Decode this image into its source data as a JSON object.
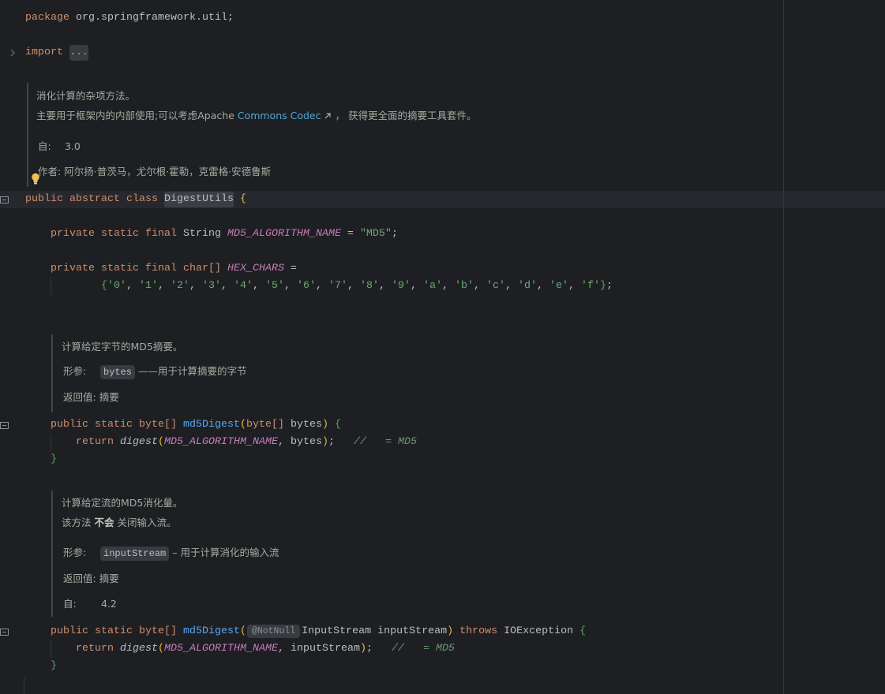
{
  "editor": {
    "colors": {
      "background": "#1e1f22",
      "caret_row": "#26282e",
      "keyword": "#cf8e6d",
      "text": "#bcbec4",
      "constant": "#c77dbb",
      "string": "#6aab73",
      "method_declaration": "#56a8f5",
      "comment": "#6b9a74",
      "bracket_level_1": "#e8ba36",
      "bracket_level_2": "#54a857",
      "doc_text": "#a3aca1",
      "doc_link": "#4ea6d8"
    },
    "icons": {
      "fold_toggle": "chevron-right-icon",
      "rendered_doc_toggle": "rendered-doc-toggle-icon",
      "intention_action": "lightbulb-icon",
      "external_link": "external-link-icon"
    }
  },
  "code": {
    "package_line": [
      "package",
      " org.springframework.util;"
    ],
    "import_line": [
      "import ",
      "..."
    ],
    "class_line": [
      "public abstract class ",
      "DigestUtils",
      " {"
    ],
    "md5_field_line": [
      "private static final",
      " String ",
      "MD5_ALGORITHM_NAME",
      " = ",
      "\"MD5\"",
      ";"
    ],
    "hex_field_line": [
      "private static final char[] ",
      "HEX_CHARS",
      " ="
    ],
    "hex_values_line": {
      "open": "{",
      "items": [
        "'0'",
        "'1'",
        "'2'",
        "'3'",
        "'4'",
        "'5'",
        "'6'",
        "'7'",
        "'8'",
        "'9'",
        "'a'",
        "'b'",
        "'c'",
        "'d'",
        "'e'",
        "'f'"
      ],
      "separator": ", ",
      "close": "}",
      "terminator": ";"
    },
    "md5_bytes_signature": [
      "public static byte[] ",
      "md5Digest",
      "(",
      "byte[]",
      " bytes",
      ")",
      " {"
    ],
    "md5_bytes_return": [
      "return ",
      "digest",
      "(",
      "MD5_ALGORITHM_NAME",
      ", bytes",
      ")",
      ";   ",
      "//   = MD5"
    ],
    "md5_bytes_close": [
      "}"
    ],
    "md5_stream_signature": [
      "public static byte[] ",
      "md5Digest",
      "(",
      "@NotNull",
      "InputStream inputStream",
      ")",
      " throws",
      " IOException",
      " {"
    ],
    "md5_stream_return": [
      "return ",
      "digest",
      "(",
      "MD5_ALGORITHM_NAME",
      ", inputStream",
      ")",
      ";   ",
      "//   = MD5"
    ],
    "md5_stream_close": [
      "}"
    ]
  },
  "docs": {
    "class_doc": {
      "summary": "消化计算的杂项方法。",
      "note_before_link": "主要用于框架内的内部使用;可以考虑Apache ",
      "link_text": "Commons Codec",
      "note_after_link": " ， 获得更全面的摘要工具套件。",
      "since_label": "自:",
      "since_value": "3.0",
      "author_label": "作者:",
      "author_value": "阿尔扬·普茨马，尤尔根·霍勒，克雷格·安德鲁斯"
    },
    "md5_bytes_doc": {
      "summary": "计算给定字节的MD5摘要。",
      "param_label": "形参:",
      "param_name": "bytes",
      "param_desc": "——用于计算摘要的字节",
      "return_label": "返回值:",
      "return_value": "摘要"
    },
    "md5_stream_doc": {
      "summary": "计算给定流的MD5消化量。",
      "note_before": "该方法 ",
      "note_bold": "不会",
      "note_after": " 关闭输入流。",
      "param_label": "形参:",
      "param_name": "inputStream",
      "param_desc": "– 用于计算消化的输入流",
      "return_label": "返回值:",
      "return_value": "摘要",
      "since_label": "自:",
      "since_value": "4.2"
    }
  }
}
